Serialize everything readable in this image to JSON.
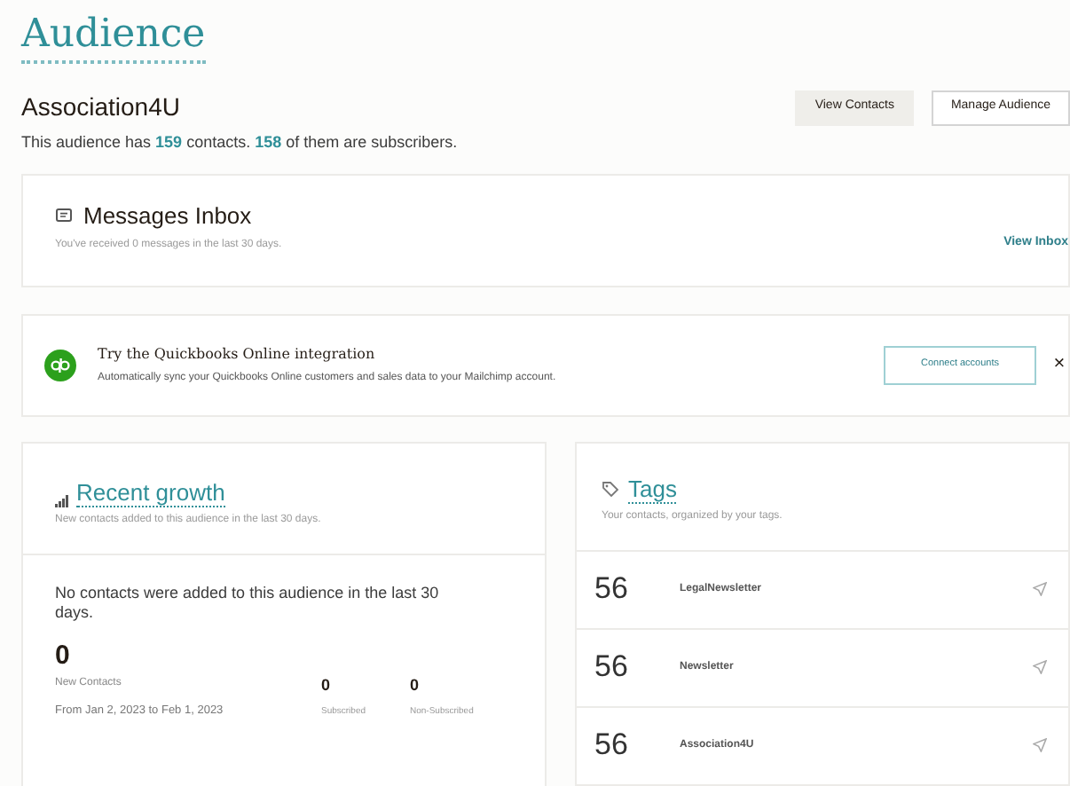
{
  "page_title": "Audience",
  "audience": {
    "name": "Association4U",
    "summary": "This audience has **159** contacts. **158** of them are subscribers.",
    "buttons": [
      {
        "label": "View Contacts",
        "kind": "filled"
      },
      {
        "label": "Manage Audience",
        "kind": "outline"
      }
    ]
  },
  "inbox": {
    "title": "Messages Inbox",
    "subtitle": "You've received 0 messages in the last 30 days.",
    "link": "View Inbox"
  },
  "promo": {
    "title": "Try the Quickbooks Online integration",
    "text": "Automatically sync your Quickbooks Online customers and sales data to your Mailchimp account.",
    "button": "Connect accounts",
    "close": "×"
  },
  "growth": {
    "title": "Recent growth",
    "subtitle": "New contacts added to this audience in the last 30 days.",
    "message": "No contacts were added to this audience in the last 30 days.",
    "count": "0",
    "count_label": "New Contacts",
    "range": "From Jan 2, 2023 to Feb 1, 2023",
    "stats": [
      {
        "value": "0",
        "label": "Subscribed"
      },
      {
        "value": "0",
        "label": "Non-Subscribed"
      }
    ]
  },
  "tags": {
    "title": "Tags",
    "subtitle": "Your contacts, organized by your tags.",
    "items": [
      {
        "count": "56",
        "name": "LegalNewsletter"
      },
      {
        "count": "56",
        "name": "Newsletter"
      },
      {
        "count": "56",
        "name": "Association4U"
      }
    ]
  }
}
